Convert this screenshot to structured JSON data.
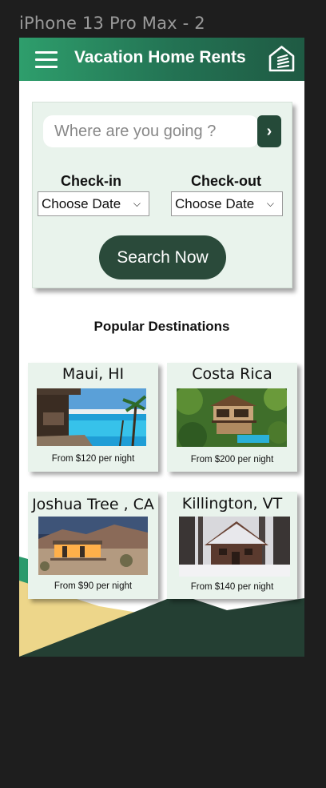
{
  "frame_label": "iPhone 13 Pro Max - 2",
  "header": {
    "title": "Vacation Home Rents",
    "menu_icon": "hamburger-menu-icon",
    "home_icon": "home-logo-icon",
    "gradient_colors": [
      "#2e9e6c",
      "#1f5a43"
    ]
  },
  "search": {
    "placeholder": "Where are you going ?",
    "go_label": "›",
    "checkin_label": "Check-in",
    "checkout_label": "Check-out",
    "checkin_value": "Choose Date",
    "checkout_value": "Choose Date",
    "submit_label": "Search Now"
  },
  "popular": {
    "title": "Popular Destinations",
    "destinations": [
      {
        "name": "Maui, HI",
        "price": "From $120 per night",
        "image": "pool-villa-photo"
      },
      {
        "name": "Costa Rica",
        "price": "From $200 per night",
        "image": "jungle-treehouse-photo"
      },
      {
        "name": "Joshua Tree , CA",
        "price": "From $90 per night",
        "image": "desert-house-photo"
      },
      {
        "name": "Killington, VT",
        "price": "From $140 per night",
        "image": "snowy-cabin-photo"
      }
    ]
  },
  "colors": {
    "accent_dark": "#2a4a3a",
    "card_bg": "#e9f3ec",
    "green_mid": "#2b9a6c",
    "sand": "#edd68a"
  }
}
